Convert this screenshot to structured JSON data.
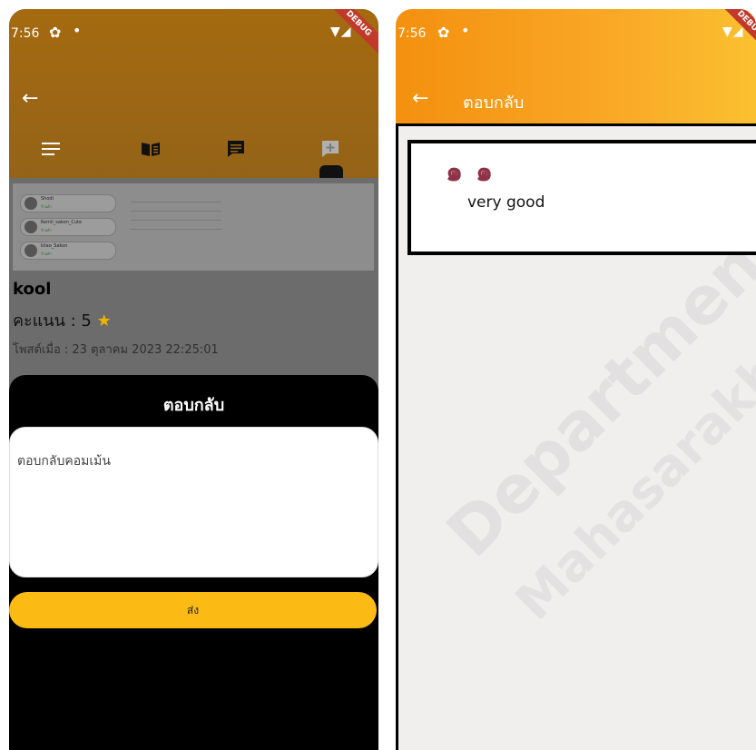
{
  "left": {
    "status": {
      "time": "7:56"
    },
    "debug": "DEBUG",
    "preview": {
      "rows": [
        {
          "name": "Shodi",
          "sub": "ร้านค้า"
        },
        {
          "name": "Kemil_sakon_Cute",
          "sub": "ร้านค้า"
        },
        {
          "name": "kilao_Sakon",
          "sub": "ร้านค้า"
        }
      ]
    },
    "review": {
      "name": "kool",
      "score_label": "คะแนน : 5",
      "star": "★",
      "date": "โพสต์เมื่อ : 23 ตุลาคม 2023 22:25:01"
    },
    "sheet": {
      "title": "ตอบกลับ",
      "input_placeholder": "ตอบกลับคอมเม้น",
      "send_label": "ส่ง"
    }
  },
  "right": {
    "status": {
      "time": "7:56"
    },
    "debug": "DEBUG",
    "title": "ตอบกลับ",
    "reply": {
      "quote": "๑๑",
      "text": "very good"
    },
    "watermark": {
      "line1": "Department",
      "line2": "Mahasarakham Univ"
    }
  },
  "colors": {
    "accent": "#fbba14",
    "header_orange": "#f4900f",
    "quote": "#8f3147"
  }
}
